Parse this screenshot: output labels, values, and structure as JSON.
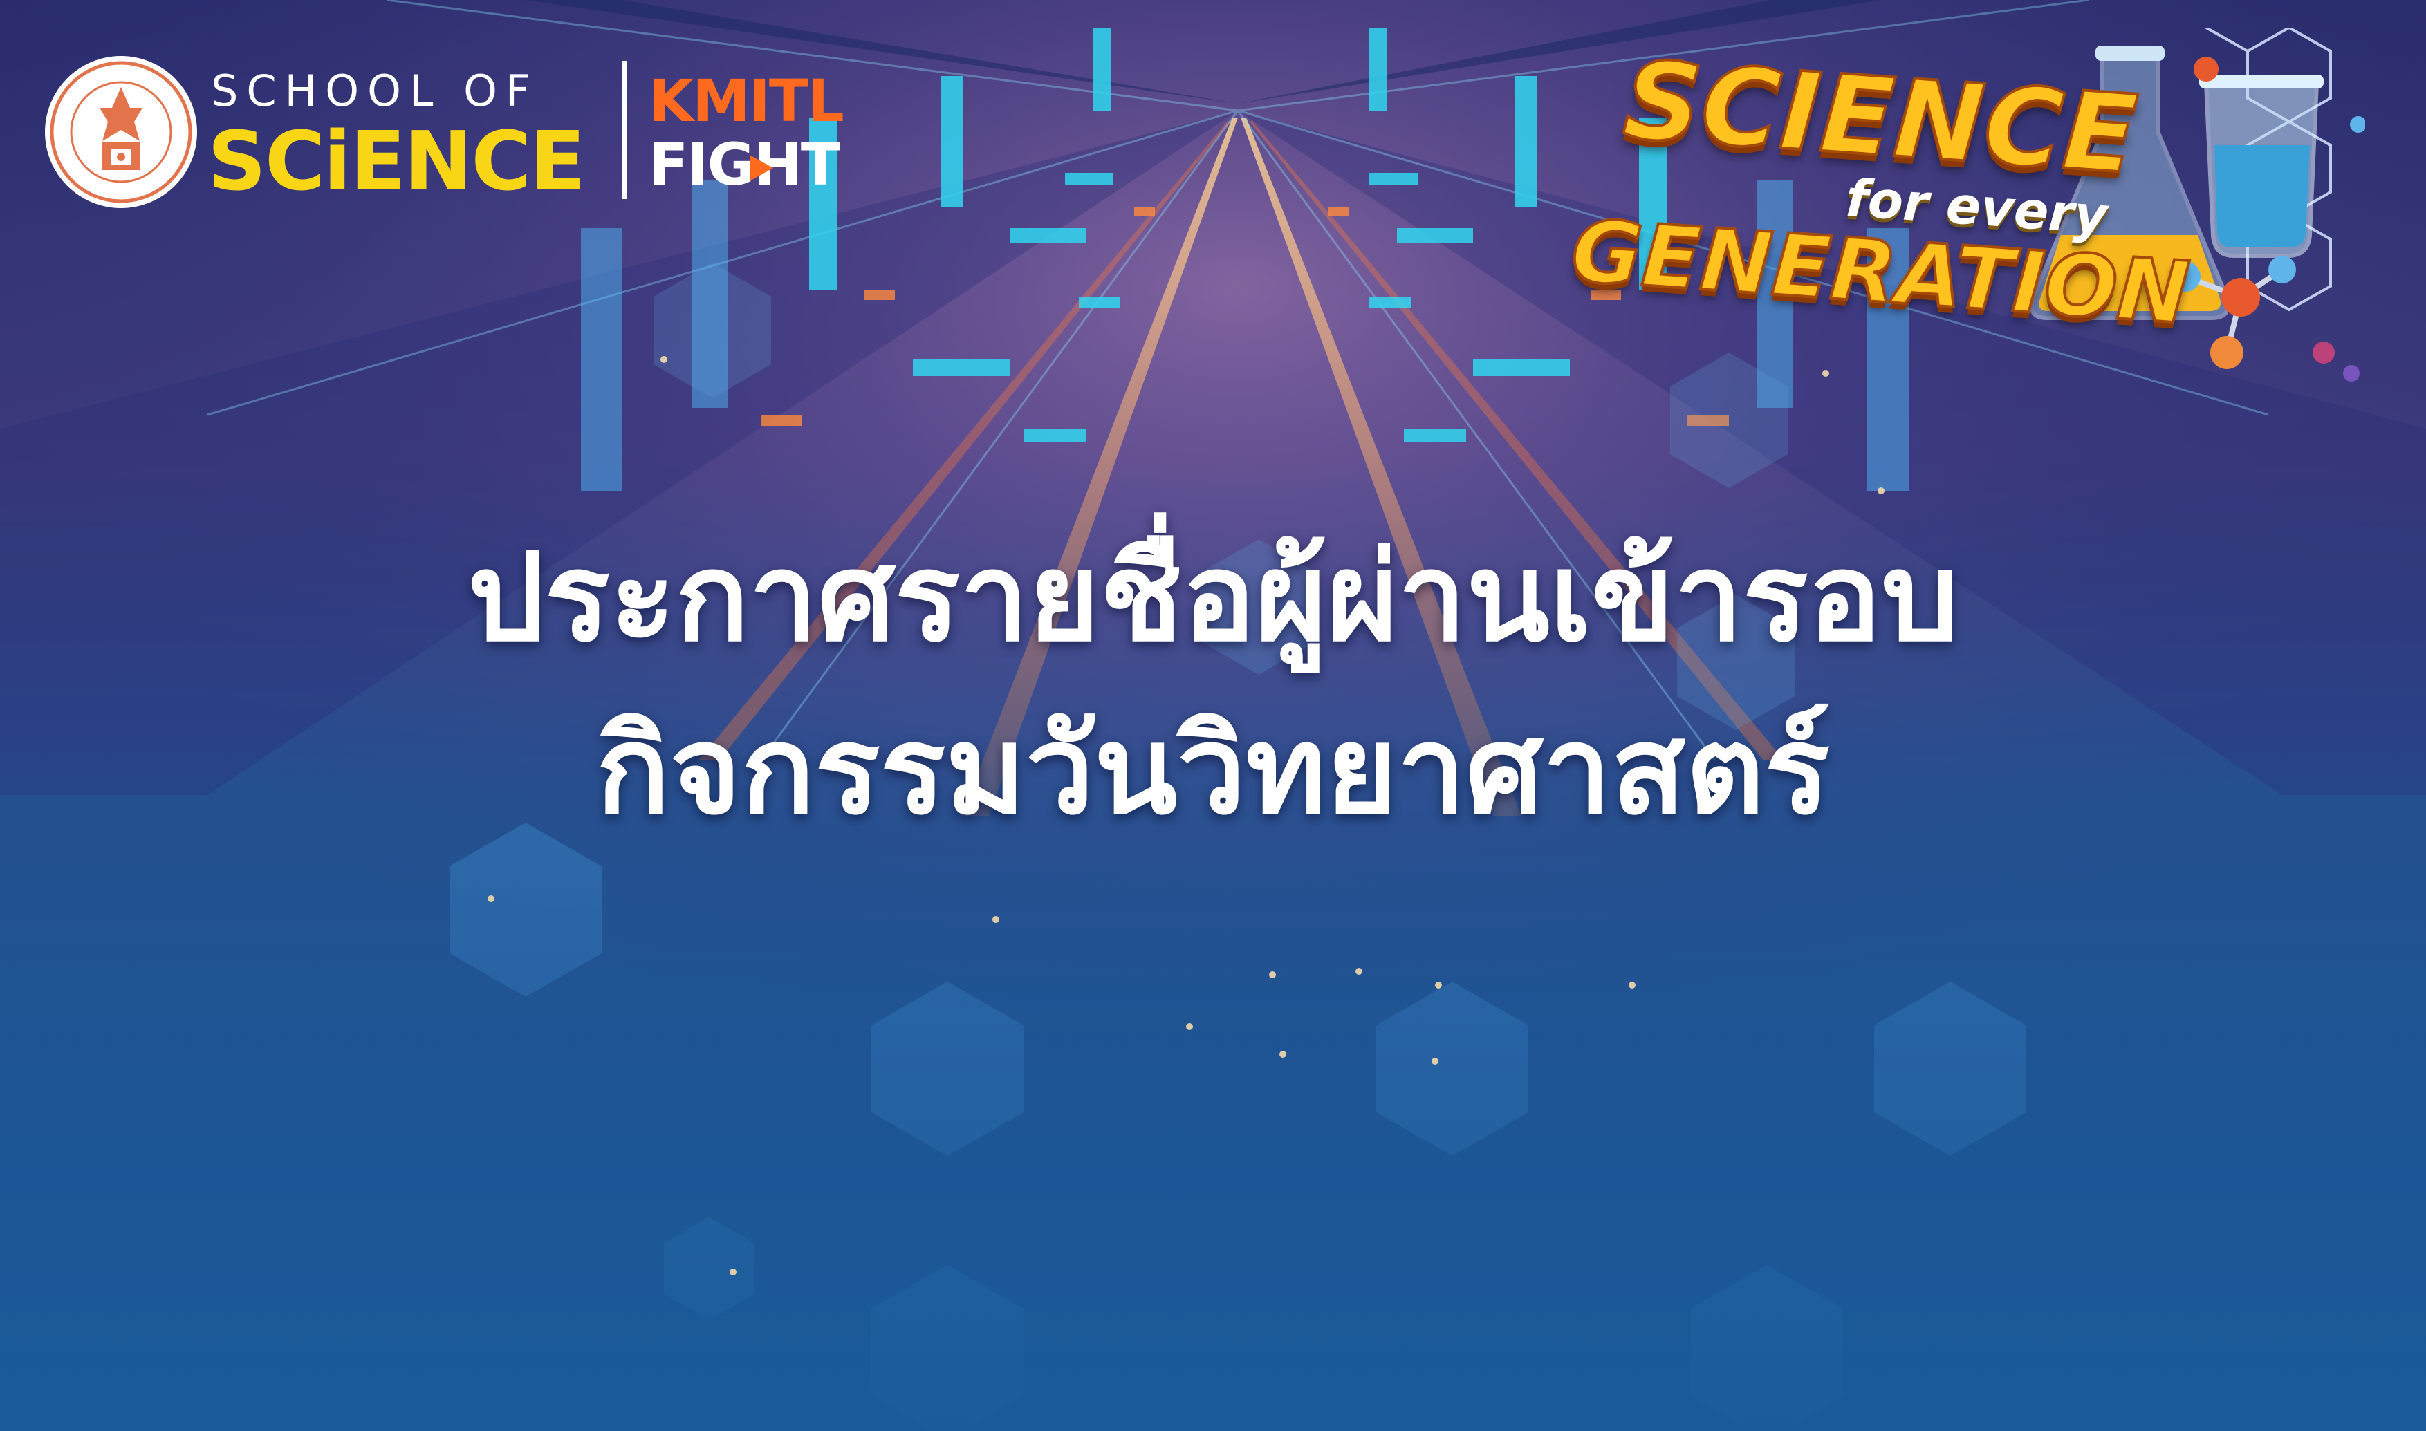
{
  "logos": {
    "school": {
      "line1": "SCHOOL OF",
      "line2": "SCiENCE",
      "seal_icon": "kmitl-seal-icon"
    },
    "fight": {
      "line1": "KMITL",
      "line2": "FIGHT",
      "play_icon": "play-triangle-icon"
    },
    "campaign": {
      "line1": "SCIENCE",
      "line2": "for every",
      "line3": "GENERATION",
      "icons": [
        "beaker-icon",
        "flask-icon",
        "molecule-icon"
      ]
    }
  },
  "headline": {
    "line1": "ประกาศรายชื่อผู้ผ่านเข้ารอบ",
    "line2": "กิจกรรมวันวิทยาศาสตร์"
  },
  "colors": {
    "background_top": "#2b2b6e",
    "background_bottom": "#1b5a9a",
    "science_yellow": "#f8d616",
    "kmitl_orange": "#ff6a1f",
    "campaign_gold": "#ffc21f",
    "neon_cyan": "#31d6f0",
    "neon_orange": "#ff8a3c"
  }
}
